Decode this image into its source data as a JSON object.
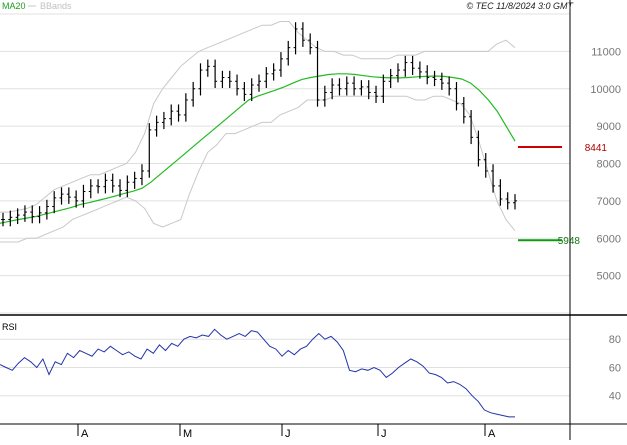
{
  "header": {
    "ma_label": "MA20",
    "bb_label": "BBands",
    "copyright": "© TEC 11/8/2024 3:0 GMT"
  },
  "colors": {
    "ma": "#22bb22",
    "bands": "#c8c8c8",
    "price": "#000000",
    "rsi": "#2233aa",
    "resistance": "#cc0000",
    "support": "#119911",
    "grid": "#e0e0e0",
    "frame": "#000000"
  },
  "chart_data": {
    "type": "line",
    "main": {
      "y_ticks": [
        5000,
        6000,
        7000,
        8000,
        9000,
        10000,
        11000
      ],
      "y_tick_labels": [
        "5000",
        "6000",
        "7000",
        "8000",
        "9000",
        "10000",
        "11000"
      ],
      "ylim": [
        4000,
        12000
      ],
      "ma20": [
        6400,
        6450,
        6500,
        6540,
        6580,
        6640,
        6700,
        6760,
        6820,
        6900,
        6950,
        7010,
        7070,
        7130,
        7200,
        7260,
        7340,
        7500,
        7700,
        7900,
        8100,
        8300,
        8500,
        8700,
        8900,
        9100,
        9300,
        9500,
        9700,
        9800,
        9880,
        9960,
        10050,
        10150,
        10250,
        10300,
        10340,
        10380,
        10400,
        10400,
        10380,
        10350,
        10320,
        10300,
        10290,
        10290,
        10300,
        10320,
        10330,
        10340,
        10330,
        10300,
        10260,
        10150,
        9950,
        9700,
        9400,
        9000,
        8600
      ],
      "bb_upper": [
        6700,
        6700,
        6750,
        6800,
        6900,
        7100,
        7300,
        7400,
        7500,
        7600,
        7700,
        7700,
        7800,
        7900,
        8000,
        8300,
        8800,
        9600,
        10000,
        10300,
        10600,
        10800,
        11000,
        11100,
        11200,
        11300,
        11400,
        11500,
        11600,
        11700,
        11700,
        11800,
        11800,
        11500,
        11300,
        11100,
        11000,
        11000,
        10900,
        10900,
        10800,
        10800,
        10800,
        10800,
        10900,
        10900,
        10900,
        11000,
        11000,
        11000,
        11000,
        11000,
        11000,
        11000,
        11000,
        11200,
        11300,
        11100
      ],
      "bb_lower": [
        5900,
        5900,
        5900,
        6000,
        6000,
        6100,
        6200,
        6300,
        6500,
        6600,
        6700,
        6800,
        6900,
        7000,
        7100,
        7000,
        6800,
        6400,
        6300,
        6400,
        6500,
        7200,
        7800,
        8300,
        8500,
        8800,
        8800,
        8900,
        9000,
        9100,
        9100,
        9300,
        9400,
        9500,
        9700,
        9700,
        9700,
        9800,
        9800,
        9800,
        9800,
        9800,
        9800,
        9800,
        9800,
        9800,
        9700,
        9700,
        9800,
        9800,
        9700,
        9600,
        9300,
        8600,
        7800,
        7000,
        6500,
        6200
      ],
      "price": [
        6500,
        6560,
        6620,
        6700,
        6580,
        6680,
        6850,
        7080,
        7180,
        7100,
        7000,
        7250,
        7400,
        7380,
        7550,
        7400,
        7280,
        7500,
        7600,
        7800,
        8900,
        9100,
        9200,
        9400,
        9300,
        9700,
        10000,
        10500,
        10600,
        10200,
        10300,
        10200,
        10000,
        9850,
        10100,
        10200,
        10400,
        10500,
        10800,
        11100,
        11600,
        11300,
        11100,
        9700,
        9900,
        10100,
        10000,
        10150,
        10000,
        10050,
        9900,
        9800,
        10200,
        10350,
        10500,
        10700,
        10550,
        10450,
        10300,
        10250,
        10150,
        10000,
        9600,
        9250,
        8700,
        8100,
        7800,
        7400,
        7050,
        6950,
        7000
      ],
      "resistance": {
        "value": 8441,
        "label": "8441"
      },
      "support": {
        "value": 5948,
        "label": "5948"
      }
    },
    "rsi": {
      "label": "RSI",
      "y_tick_labels": [
        "80",
        "60",
        "40"
      ],
      "values": [
        62,
        60,
        58,
        63,
        67,
        64,
        60,
        66,
        55,
        64,
        62,
        70,
        67,
        72,
        70,
        68,
        73,
        71,
        75,
        72,
        69,
        71,
        68,
        66,
        73,
        70,
        76,
        72,
        77,
        75,
        80,
        82,
        81,
        83,
        82,
        87,
        83,
        80,
        82,
        84,
        82,
        86,
        85,
        80,
        75,
        73,
        68,
        72,
        69,
        73,
        75,
        80,
        84,
        80,
        82,
        78,
        72,
        58,
        57,
        59,
        58,
        60,
        58,
        53,
        56,
        60,
        63,
        66,
        64,
        61,
        56,
        55,
        53,
        49,
        50,
        48,
        45,
        40,
        36,
        30,
        28,
        27,
        26,
        25,
        25
      ]
    },
    "x_tick_labels": [
      "A",
      "M",
      "J",
      "J",
      "A"
    ]
  }
}
